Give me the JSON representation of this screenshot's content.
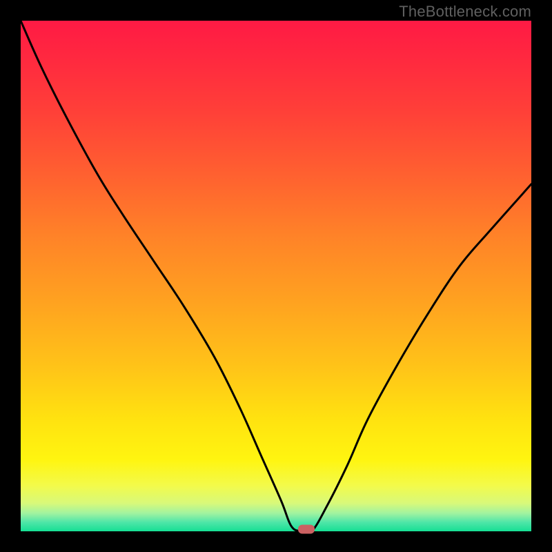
{
  "watermark": "TheBottleneck.com",
  "gradient_stops": [
    {
      "offset": 0.0,
      "color": "#ff1a44"
    },
    {
      "offset": 0.08,
      "color": "#ff2a3f"
    },
    {
      "offset": 0.18,
      "color": "#ff4038"
    },
    {
      "offset": 0.3,
      "color": "#ff6030"
    },
    {
      "offset": 0.42,
      "color": "#ff8228"
    },
    {
      "offset": 0.55,
      "color": "#ffa220"
    },
    {
      "offset": 0.68,
      "color": "#ffc418"
    },
    {
      "offset": 0.78,
      "color": "#ffe210"
    },
    {
      "offset": 0.86,
      "color": "#fff510"
    },
    {
      "offset": 0.91,
      "color": "#f3fa4a"
    },
    {
      "offset": 0.945,
      "color": "#d8f97a"
    },
    {
      "offset": 0.965,
      "color": "#a0f3a0"
    },
    {
      "offset": 0.982,
      "color": "#50e6a8"
    },
    {
      "offset": 1.0,
      "color": "#16df94"
    }
  ],
  "chart_data": {
    "type": "line",
    "title": "",
    "xlabel": "",
    "ylabel": "",
    "xlim": [
      0,
      100
    ],
    "ylim": [
      0,
      100
    ],
    "grid": false,
    "legend": false,
    "series": [
      {
        "name": "curve",
        "x": [
          0,
          4,
          9,
          15,
          20,
          26,
          32,
          38,
          43,
          47,
          51,
          53,
          55,
          57,
          60,
          64,
          68,
          74,
          80,
          86,
          92,
          100
        ],
        "y": [
          100,
          91,
          81,
          70,
          62,
          53,
          44,
          34,
          24,
          15,
          6,
          1,
          0,
          0,
          5,
          13,
          22,
          33,
          43,
          52,
          59,
          68
        ]
      }
    ],
    "flat_segment": {
      "x_start": 53,
      "x_end": 57,
      "y": 0
    },
    "marker": {
      "x": 56,
      "y": 0,
      "color": "#cb6162"
    },
    "annotations": []
  }
}
